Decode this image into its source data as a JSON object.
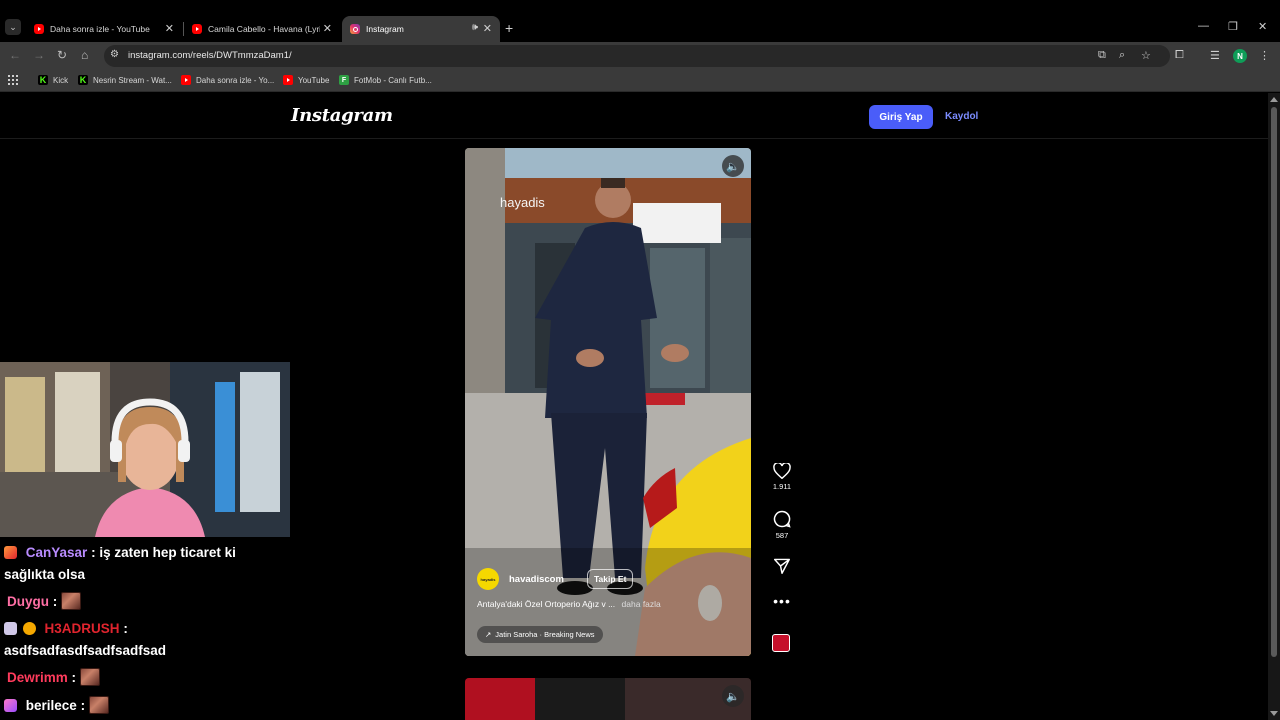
{
  "browser": {
    "tabs": [
      {
        "title": "Daha sonra izle - YouTube",
        "icon": "youtube-icon",
        "active": false
      },
      {
        "title": "Camila Cabello - Havana (Lyrics",
        "icon": "youtube-icon",
        "active": false
      },
      {
        "title": "Instagram",
        "icon": "instagram-icon",
        "active": true
      }
    ],
    "new_tab": "+",
    "url": "instagram.com/reels/DWTmmzaDam1/",
    "profile_initial": "N",
    "bookmarks": [
      {
        "label": "Kick",
        "icon": "kick-icon"
      },
      {
        "label": "Nesrin Stream - Wat...",
        "icon": "kick-icon"
      },
      {
        "label": "Daha sonra izle - Yo...",
        "icon": "youtube-icon"
      },
      {
        "label": "YouTube",
        "icon": "youtube-icon"
      },
      {
        "label": "FotMob - Canlı Futb...",
        "icon": "fotmob-icon"
      }
    ]
  },
  "instagram": {
    "logo": "Instagram",
    "login_label": "Giriş Yap",
    "signup_label": "Kaydol",
    "reel": {
      "watermark": "hayadis",
      "username": "havadiscom",
      "avatar_text": "hayadis",
      "follow_label": "Takip Et",
      "caption": "Antalya'daki Özel Ortoperio Ağız v ...",
      "more_label": "daha fazla",
      "audio": "Jatin Saroha · Breaking News",
      "likes": "1.911",
      "comments": "587"
    }
  },
  "chat": [
    {
      "user": "CanYasar",
      "user_color": "#b98cff",
      "text": ": iş zaten hep ticaret ki",
      "cont": "sağlıkta olsa",
      "emote": false
    },
    {
      "user": "Duygu",
      "user_color": "#ff6fa5",
      "text": ":",
      "emote": true
    },
    {
      "user": "H3ADRUSH",
      "user_color": "#e0242e",
      "text": ":",
      "cont": "asdfsadfasdfsadfsadfsad",
      "emote": false
    },
    {
      "user": "Dewrimm",
      "user_color": "#ff3b5c",
      "text": ":",
      "emote": true
    },
    {
      "user": "berilece",
      "user_color": "#ffffff",
      "text": ":",
      "emote": true
    }
  ]
}
